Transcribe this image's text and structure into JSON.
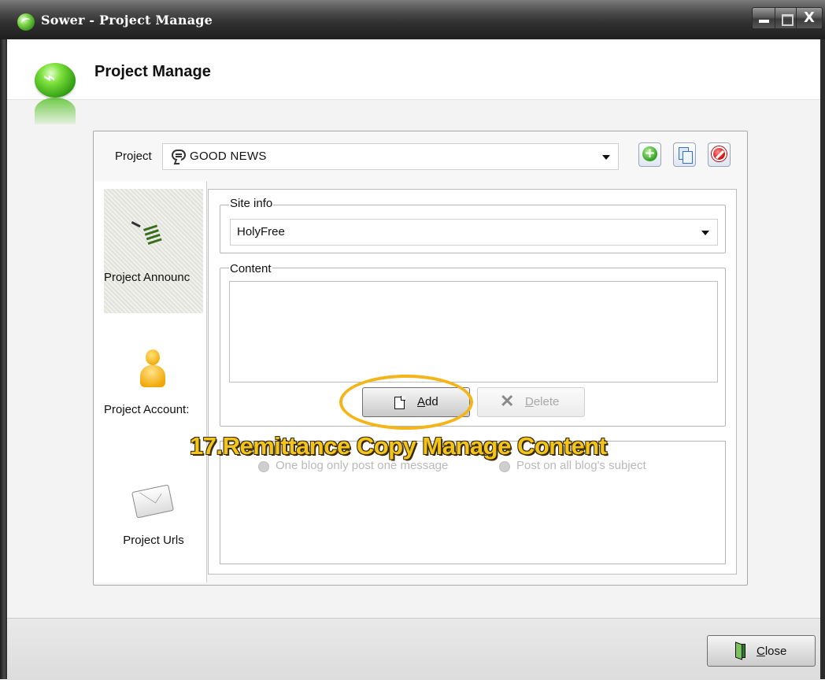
{
  "window": {
    "title": "Sower - Project Manage",
    "controls": {
      "close_glyph": "X"
    }
  },
  "header": {
    "title": "Project Manage"
  },
  "project_bar": {
    "label": "Project",
    "selected": "GOOD NEWS",
    "icons": [
      "speech-bubble-icon",
      "add-project-icon",
      "copy-project-icon",
      "delete-project-icon"
    ]
  },
  "nav": {
    "items": [
      {
        "label": "Project Announc",
        "icon": "announcement-icon",
        "selected": true
      },
      {
        "label": "Project Account:",
        "icon": "account-person-icon",
        "selected": false
      },
      {
        "label": "Project Urls",
        "icon": "envelope-icon",
        "selected": false
      }
    ]
  },
  "site_info": {
    "legend": "Site info",
    "selected": "HolyFree"
  },
  "content": {
    "legend": "Content",
    "text": "",
    "add_label_first": "A",
    "add_label_rest": "dd",
    "delete_label_first": "D",
    "delete_label_rest": "elete"
  },
  "options": {
    "radio1": "One blog only post one message",
    "radio2": "Post on all blog's subject"
  },
  "caption": "17.Remittance Copy Manage Content",
  "footer": {
    "close_label_first": "C",
    "close_label_rest": "lose"
  },
  "colors": {
    "highlight": "#f4b51a",
    "caption": "#f3c51a"
  }
}
